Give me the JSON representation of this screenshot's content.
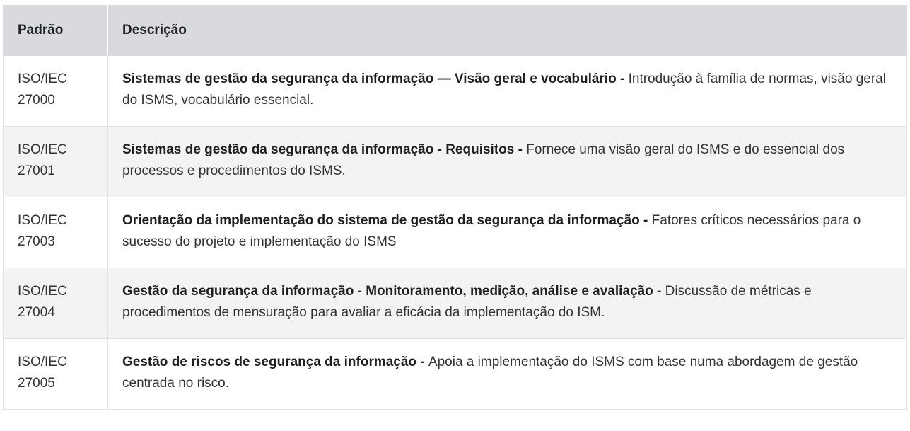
{
  "header": {
    "col_standard": "Padrão",
    "col_description": "Descrição"
  },
  "rows": [
    {
      "standard_line1": "ISO/IEC",
      "standard_line2": "27000",
      "title": "Sistemas de gestão da segurança da informação — Visão geral e vocabulário",
      "sep": " - ",
      "text": "Introdução à família de normas, visão geral do ISMS, vocabulário essencial."
    },
    {
      "standard_line1": "ISO/IEC",
      "standard_line2": "27001",
      "title": "Sistemas de gestão da segurança da informação - Requisitos",
      "sep": " - ",
      "text": "Fornece uma visão geral do ISMS e do essencial dos processos e procedimentos do ISMS."
    },
    {
      "standard_line1": "ISO/IEC",
      "standard_line2": "27003",
      "title": "Orientação da implementação do sistema de gestão da segurança da informação",
      "sep": " - ",
      "text": "Fatores críticos necessários para o sucesso do projeto e implementação do ISMS"
    },
    {
      "standard_line1": "ISO/IEC",
      "standard_line2": "27004",
      "title": "Gestão da segurança da informação - Monitoramento, medição, análise e avaliação",
      "sep": " - ",
      "text": "Discussão de métricas e procedimentos de mensuração para avaliar a eficácia da implementação do ISM."
    },
    {
      "standard_line1": "ISO/IEC",
      "standard_line2": "27005",
      "title": "Gestão de riscos de segurança da informação",
      "sep": " - ",
      "text": "Apoia a implementação do ISMS com base numa abordagem de gestão centrada no risco."
    }
  ]
}
